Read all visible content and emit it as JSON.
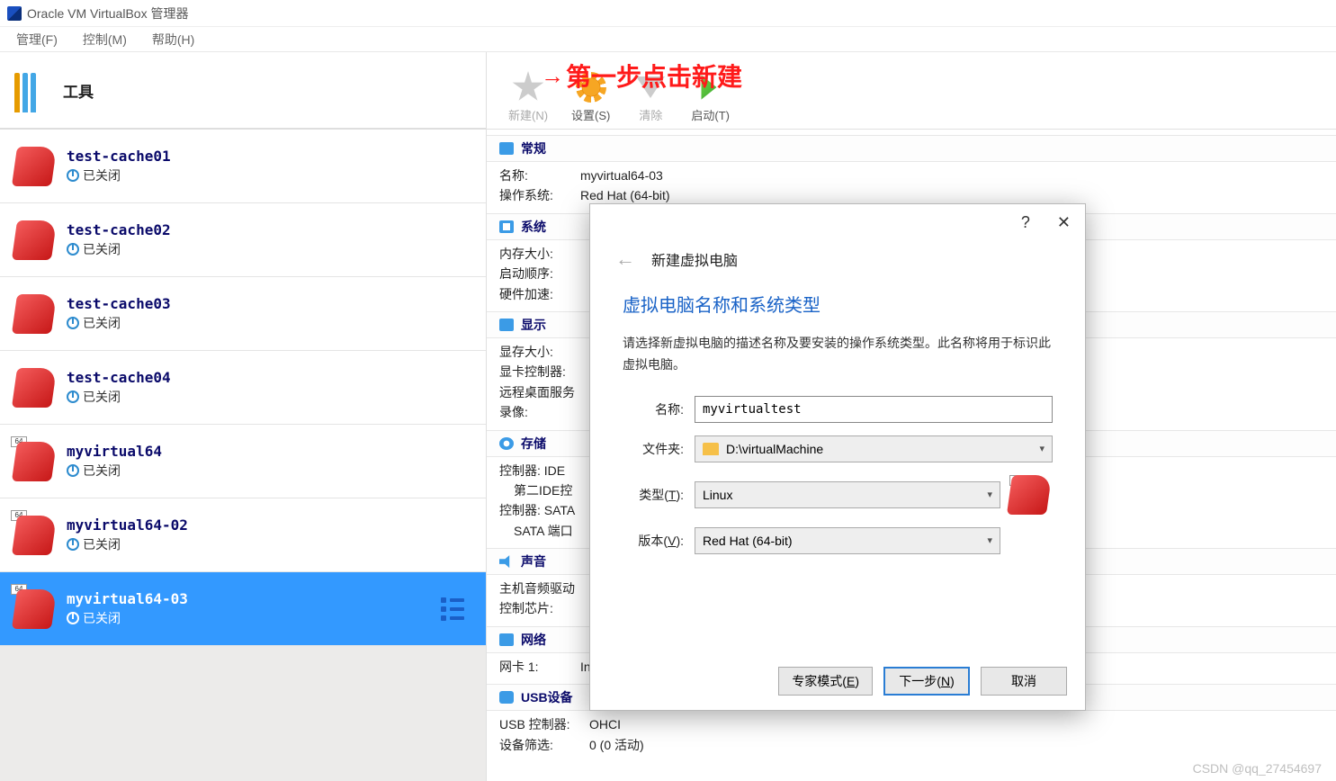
{
  "window": {
    "title": "Oracle VM VirtualBox 管理器"
  },
  "menu": {
    "manage": "管理(F)",
    "control": "控制(M)",
    "help": "帮助(H)"
  },
  "sidebar": {
    "tools_label": "工具",
    "status_off": "已关闭",
    "badge64": "64",
    "vms": [
      {
        "name": "test-cache01"
      },
      {
        "name": "test-cache02"
      },
      {
        "name": "test-cache03"
      },
      {
        "name": "test-cache04"
      },
      {
        "name": "myvirtual64"
      },
      {
        "name": "myvirtual64-02"
      },
      {
        "name": "myvirtual64-03"
      }
    ]
  },
  "toolbar": {
    "new": "新建(N)",
    "settings": "设置(S)",
    "discard": "清除",
    "start": "启动(T)"
  },
  "annotation": {
    "text": "第一步点击新建"
  },
  "details": {
    "general": {
      "title": "常规",
      "name_k": "名称:",
      "name_v": "myvirtual64-03",
      "os_k": "操作系统:",
      "os_v": "Red Hat (64-bit)"
    },
    "system": {
      "title": "系统",
      "mem_k": "内存大小:",
      "boot_k": "启动顺序:",
      "accel_k": "硬件加速:"
    },
    "display": {
      "title": "显示",
      "vram_k": "显存大小:",
      "ctrl_k": "显卡控制器:",
      "rdp_k": "远程桌面服务",
      "rec_k": "录像:"
    },
    "storage": {
      "title": "存储",
      "ide_k": "控制器: IDE",
      "ide2": "第二IDE控",
      "sata_k": "控制器: SATA",
      "sata_port": "SATA 端口"
    },
    "audio": {
      "title": "声音",
      "host_k": "主机音频驱动",
      "chip_k": "控制芯片:"
    },
    "network": {
      "title": "网络",
      "nic1_k": "网卡 1:",
      "nic1_v": "In"
    },
    "usb": {
      "title": "USB设备",
      "ctrl_k": "USB 控制器:",
      "ctrl_v": "OHCI",
      "filter_k": "设备筛选:",
      "filter_v": "0 (0 活动)"
    }
  },
  "dialog": {
    "header": "新建虚拟电脑",
    "h2": "虚拟电脑名称和系统类型",
    "desc": "请选择新虚拟电脑的描述名称及要安装的操作系统类型。此名称将用于标识此虚拟电脑。",
    "labels": {
      "name": "名称:",
      "folder": "文件夹:",
      "type": "类型(T):",
      "version": "版本(V):"
    },
    "values": {
      "name": "myvirtualtest",
      "folder": "D:\\virtualMachine",
      "type": "Linux",
      "version": "Red Hat (64-bit)"
    },
    "buttons": {
      "expert": "专家模式(E)",
      "next": "下一步(N)",
      "cancel": "取消"
    }
  },
  "watermark": "CSDN @qq_27454697"
}
